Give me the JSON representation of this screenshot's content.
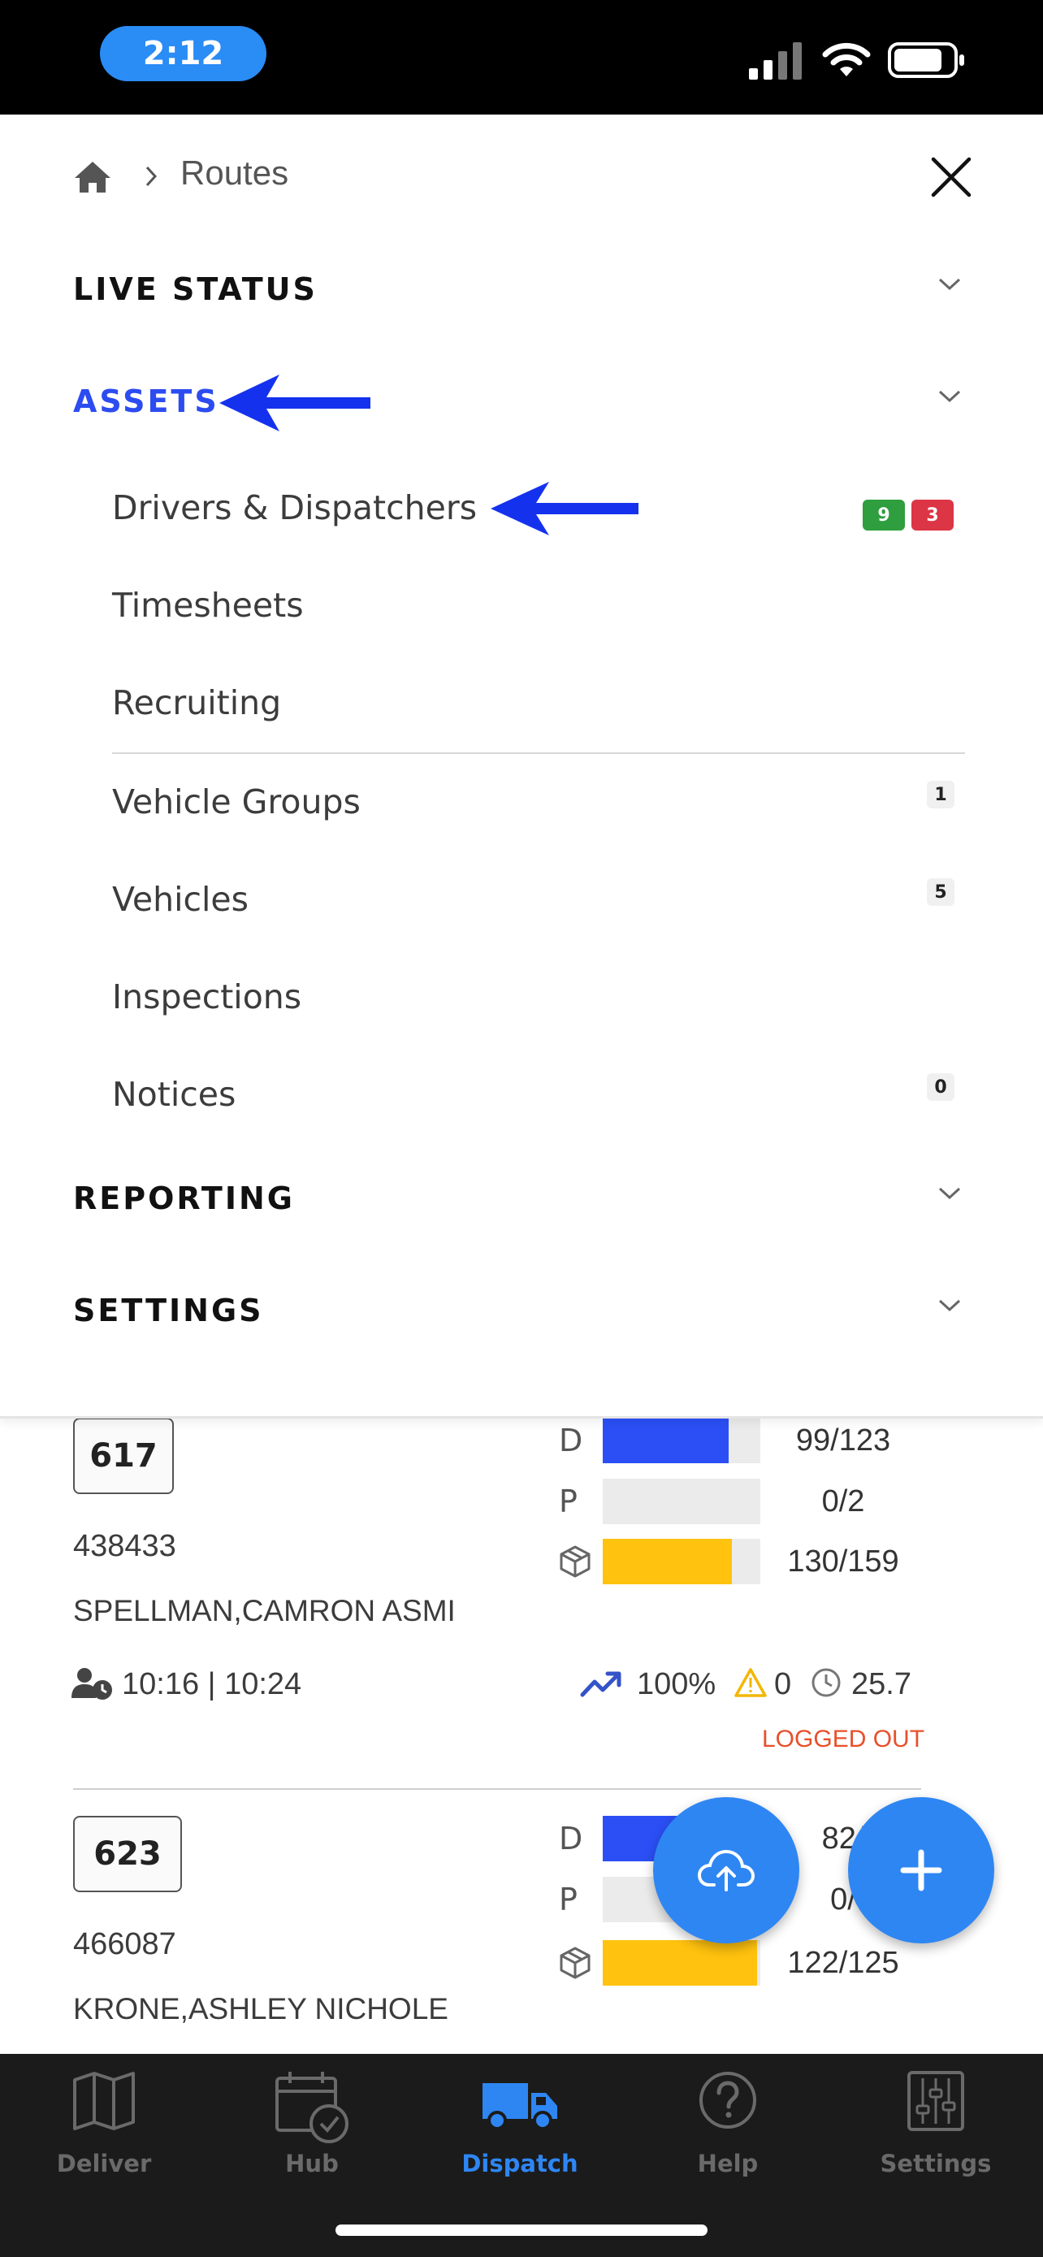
{
  "status_bar": {
    "time": "2:12"
  },
  "menu": {
    "breadcrumb": {
      "current": "Routes"
    },
    "sections": {
      "live_status": "LIVE STATUS",
      "assets": "ASSETS",
      "reporting": "REPORTING",
      "settings": "SETTINGS"
    },
    "assets_items": {
      "drivers": {
        "label": "Drivers & Dispatchers",
        "badge_green": "9",
        "badge_red": "3"
      },
      "timesheets": {
        "label": "Timesheets"
      },
      "recruiting": {
        "label": "Recruiting"
      },
      "vehicle_groups": {
        "label": "Vehicle Groups",
        "badge": "1"
      },
      "vehicles": {
        "label": "Vehicles",
        "badge": "5"
      },
      "inspections": {
        "label": "Inspections"
      },
      "notices": {
        "label": "Notices",
        "badge": "0"
      }
    }
  },
  "routes": [
    {
      "route_number": "617",
      "id": "438433",
      "driver": "SPELLMAN,CAMRON ASMI",
      "times": "10:16 | 10:24",
      "bars": {
        "d": {
          "letter": "D",
          "value": "99/123",
          "fill": 0.8
        },
        "p": {
          "letter": "P",
          "value": "0/2",
          "fill": 0
        },
        "pkg": {
          "value": "130/159",
          "fill": 0.82
        }
      },
      "performance": "100%",
      "warnings": "0",
      "duration": "25.7",
      "status": "LOGGED OUT"
    },
    {
      "route_number": "623",
      "id": "466087",
      "driver": "KRONE,ASHLEY NICHOLE",
      "bars": {
        "d": {
          "letter": "D",
          "value": "82/",
          "fill": 0.75
        },
        "p": {
          "letter": "P",
          "value": "0/",
          "fill": 0
        },
        "pkg": {
          "value": "122/125",
          "fill": 0.98
        }
      }
    }
  ],
  "tabs": {
    "deliver": "Deliver",
    "hub": "Hub",
    "dispatch": "Dispatch",
    "help": "Help",
    "settings": "Settings"
  },
  "colors": {
    "accent_blue": "#2c4cf0",
    "fab_blue": "#2e86f3",
    "bar_blue": "#2b4ff5",
    "bar_yellow": "#ffc20e",
    "badge_green": "#2e9e3e",
    "badge_red": "#dc3545",
    "status_orange": "#e8502a"
  }
}
